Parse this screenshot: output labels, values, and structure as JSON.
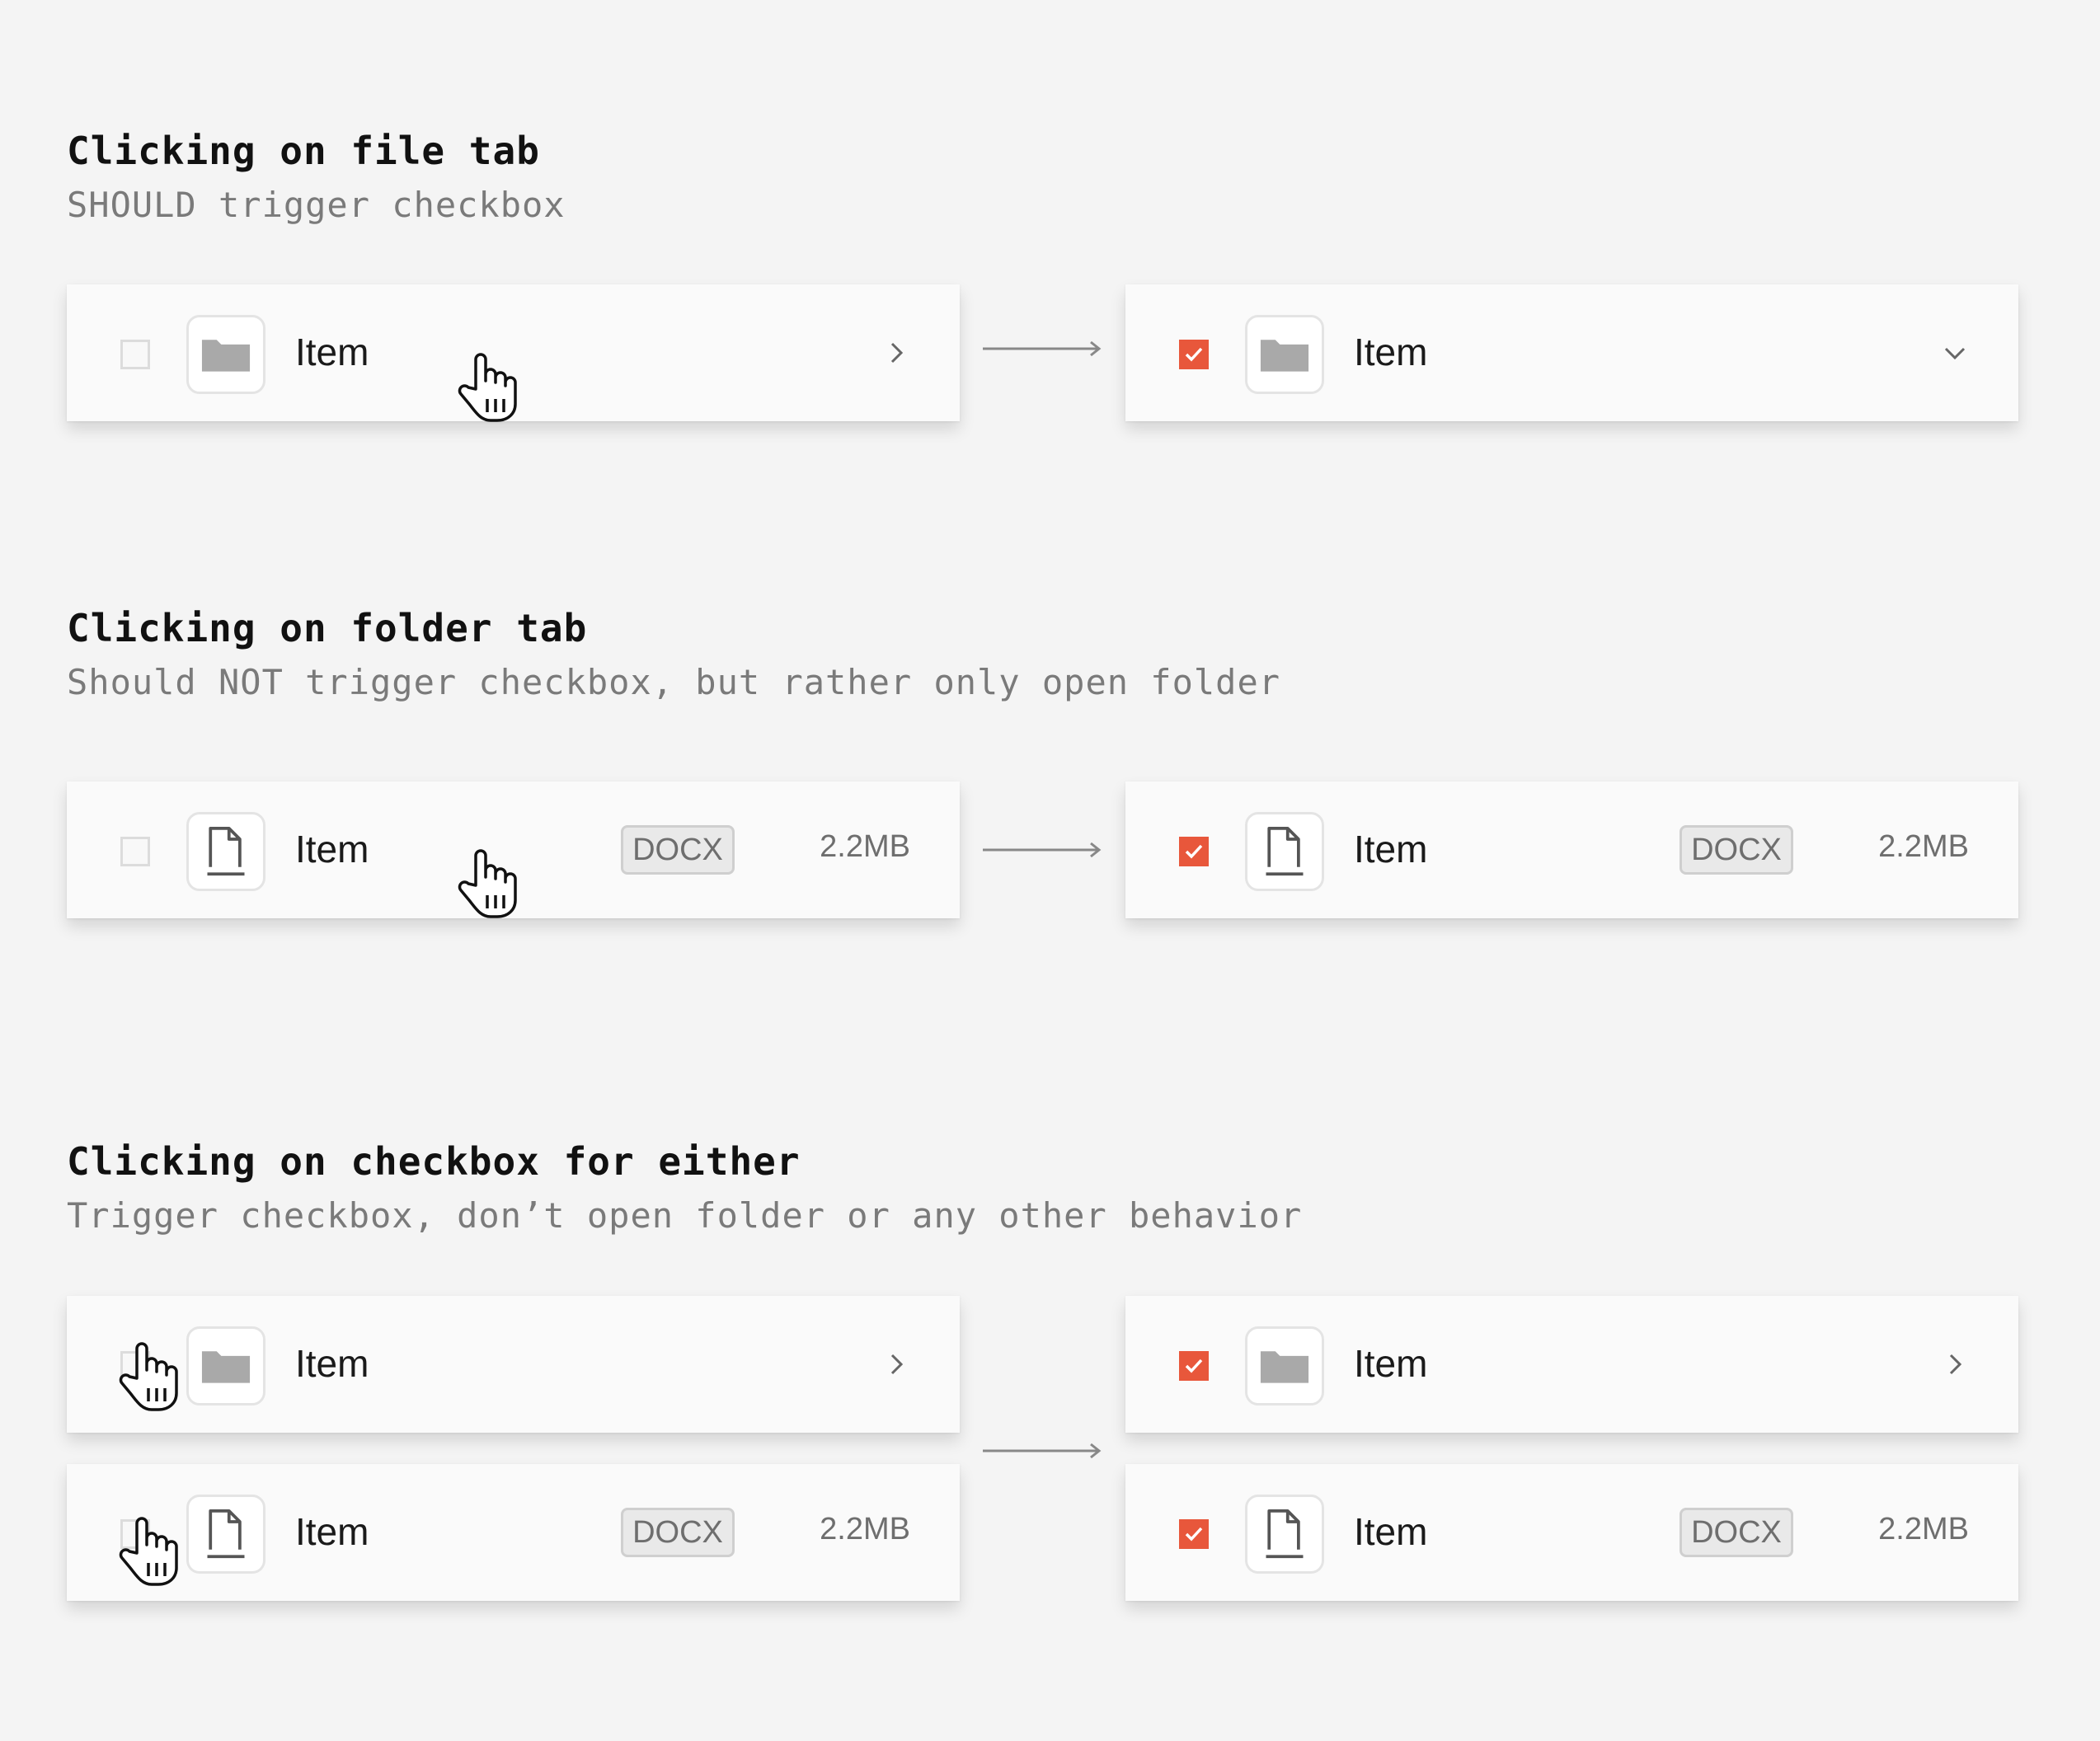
{
  "sections": [
    {
      "title": "Clicking on file tab",
      "subtitle": "SHOULD trigger checkbox",
      "before": {
        "type": "folder",
        "checked": false,
        "label": "Item",
        "chevron": "chevron-right-icon"
      },
      "after": {
        "type": "folder",
        "checked": true,
        "label": "Item",
        "chevron": "chevron-down-icon"
      }
    },
    {
      "title": "Clicking on folder tab",
      "subtitle": "Should NOT trigger checkbox, but rather only open folder",
      "before": {
        "type": "file",
        "checked": false,
        "label": "Item",
        "badge": "DOCX",
        "size": "2.2MB"
      },
      "after": {
        "type": "file",
        "checked": true,
        "label": "Item",
        "badge": "DOCX",
        "size": "2.2MB"
      }
    },
    {
      "title": "Clicking on checkbox for either",
      "subtitle": "Trigger checkbox, don’t open folder or any other behavior",
      "before": [
        {
          "type": "folder",
          "checked": false,
          "label": "Item",
          "chevron": "chevron-right-icon"
        },
        {
          "type": "file",
          "checked": false,
          "label": "Item",
          "badge": "DOCX",
          "size": "2.2MB"
        }
      ],
      "after": [
        {
          "type": "folder",
          "checked": true,
          "label": "Item",
          "chevron": "chevron-right-icon"
        },
        {
          "type": "file",
          "checked": true,
          "label": "Item",
          "badge": "DOCX",
          "size": "2.2MB"
        }
      ]
    }
  ],
  "colors": {
    "background": "#f4f4f4",
    "row_background": "#fafafa",
    "checkbox_checked": "#e8573b",
    "folder_icon": "#a9a9a9",
    "file_icon": "#555555",
    "badge_background": "#e9e9e9",
    "heading_text": "#111111",
    "subheading_text": "#7a7a7a"
  },
  "icons": {
    "folder": "folder-icon",
    "file": "file-icon",
    "cursor": "hand-pointer-icon",
    "arrow": "arrow-right-icon"
  }
}
